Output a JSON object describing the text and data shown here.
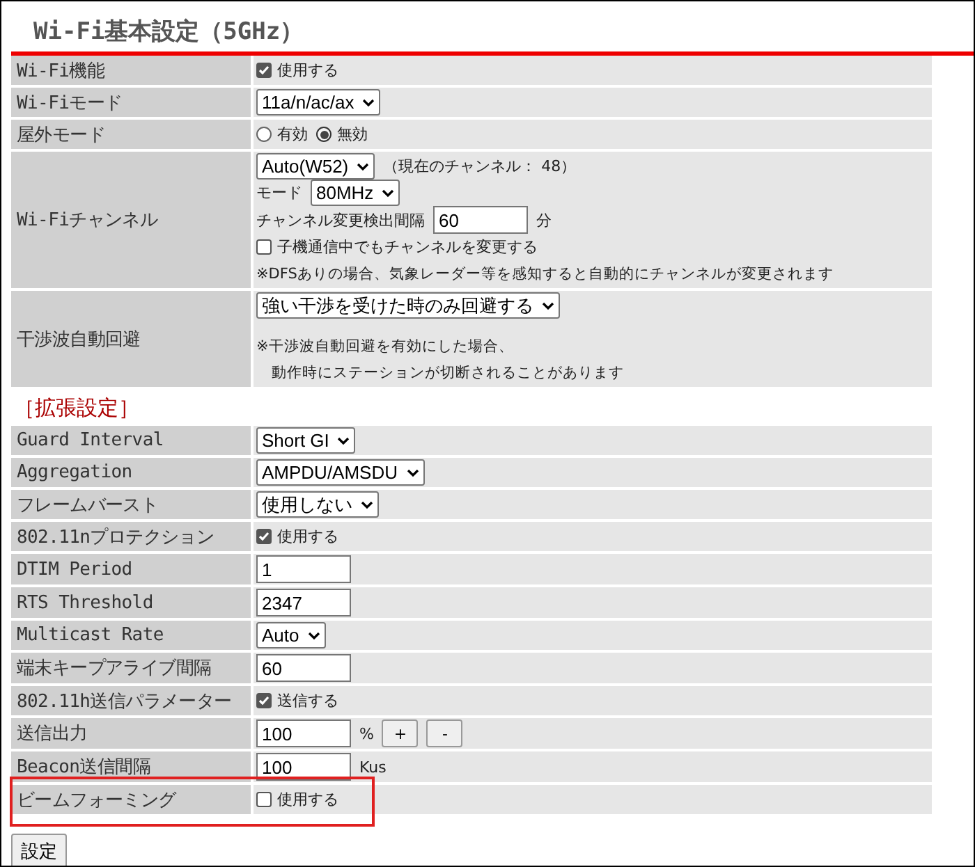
{
  "title": "Wi-Fi基本設定（5GHz）",
  "basic_rows": [
    {
      "label": "Wi-Fi機能",
      "lines": [
        [
          {
            "kind": "checkbox",
            "label": "使用する",
            "checked": true
          }
        ]
      ]
    },
    {
      "label": "Wi-Fiモード",
      "lines": [
        [
          {
            "kind": "select",
            "value": "11a/n/ac/ax"
          }
        ]
      ]
    },
    {
      "label": "屋外モード",
      "lines": [
        [
          {
            "kind": "radio",
            "label": "有効",
            "selected": false
          },
          {
            "kind": "radio",
            "label": "無効",
            "selected": true
          }
        ]
      ]
    },
    {
      "label": "Wi-Fiチャンネル",
      "lines": [
        [
          {
            "kind": "select",
            "value": "Auto(W52)"
          },
          {
            "kind": "text",
            "text": "（現在のチャンネル： 48）"
          }
        ],
        [
          {
            "kind": "text",
            "text": "モード"
          },
          {
            "kind": "select",
            "value": "80MHz"
          }
        ],
        [
          {
            "kind": "text",
            "text": "チャンネル変更検出間隔"
          },
          {
            "kind": "input",
            "value": "60"
          },
          {
            "kind": "text",
            "text": "分"
          }
        ],
        [
          {
            "kind": "checkbox",
            "label": "子機通信中でもチャンネルを変更する",
            "checked": false
          }
        ],
        [
          {
            "kind": "note",
            "text": "※DFSありの場合、気象レーダー等を感知すると自動的にチャンネルが変更されます"
          }
        ]
      ]
    },
    {
      "label": "干渉波自動回避",
      "lines": [
        [
          {
            "kind": "select",
            "value": "強い干渉を受けた時のみ回避する"
          }
        ],
        [
          {
            "kind": "note",
            "text": "※干渉波自動回避を有効にした場合、"
          }
        ],
        [
          {
            "kind": "note",
            "text": "　動作時にステーションが切断されることがあります"
          }
        ]
      ]
    }
  ],
  "section_heading": "［拡張設定］",
  "advanced_rows": [
    {
      "label": "Guard Interval",
      "lines": [
        [
          {
            "kind": "select",
            "value": "Short GI"
          }
        ]
      ]
    },
    {
      "label": "Aggregation",
      "lines": [
        [
          {
            "kind": "select",
            "value": "AMPDU/AMSDU"
          }
        ]
      ]
    },
    {
      "label": "フレームバースト",
      "lines": [
        [
          {
            "kind": "select",
            "value": "使用しない"
          }
        ]
      ]
    },
    {
      "label": "802.11nプロテクション",
      "lines": [
        [
          {
            "kind": "checkbox",
            "label": "使用する",
            "checked": true
          }
        ]
      ]
    },
    {
      "label": "DTIM Period",
      "lines": [
        [
          {
            "kind": "input",
            "value": "1"
          }
        ]
      ]
    },
    {
      "label": "RTS Threshold",
      "lines": [
        [
          {
            "kind": "input",
            "value": "2347"
          }
        ]
      ]
    },
    {
      "label": "Multicast Rate",
      "lines": [
        [
          {
            "kind": "select",
            "value": "Auto"
          }
        ]
      ]
    },
    {
      "label": "端末キープアライブ間隔",
      "lines": [
        [
          {
            "kind": "input",
            "value": "60"
          }
        ]
      ]
    },
    {
      "label": "802.11h送信パラメーター",
      "lines": [
        [
          {
            "kind": "checkbox",
            "label": "送信する",
            "checked": true
          }
        ]
      ]
    },
    {
      "label": "送信出力",
      "lines": [
        [
          {
            "kind": "input",
            "value": "100"
          },
          {
            "kind": "text",
            "text": "%"
          },
          {
            "kind": "button",
            "label": "+"
          },
          {
            "kind": "button",
            "label": "-"
          }
        ]
      ]
    },
    {
      "label": "Beacon送信間隔",
      "lines": [
        [
          {
            "kind": "input",
            "value": "100"
          },
          {
            "kind": "text",
            "text": "Kus"
          }
        ]
      ]
    },
    {
      "label": "ビームフォーミング",
      "highlighted": true,
      "lines": [
        [
          {
            "kind": "checkbox",
            "label": "使用する",
            "checked": false
          }
        ]
      ]
    }
  ],
  "submit": "設定"
}
